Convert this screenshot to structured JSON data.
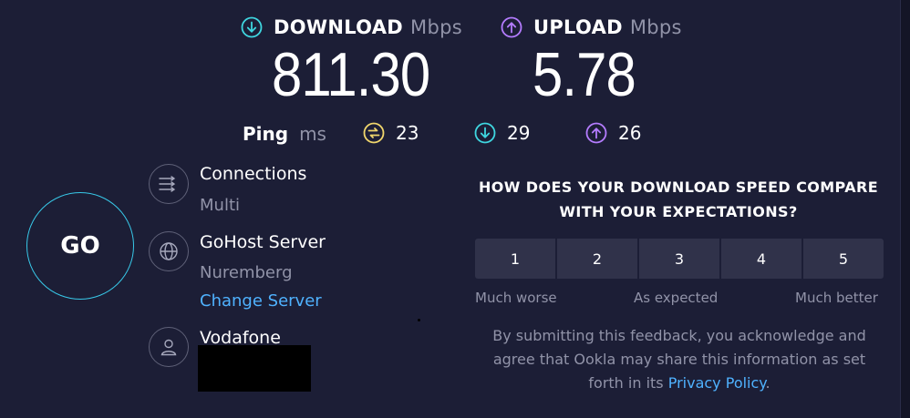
{
  "download": {
    "label": "DOWNLOAD",
    "unit": "Mbps",
    "value": "811.30",
    "icon": "download-arrow-icon",
    "color": "#3fd6e0"
  },
  "upload": {
    "label": "UPLOAD",
    "unit": "Mbps",
    "value": "5.78",
    "icon": "upload-arrow-icon",
    "color": "#b47cff"
  },
  "ping": {
    "label": "Ping",
    "unit": "ms",
    "idle": {
      "value": "23",
      "icon": "ping-idle-icon",
      "color": "#f0d66c"
    },
    "download": {
      "value": "29",
      "icon": "ping-download-icon",
      "color": "#3fd6e0"
    },
    "upload": {
      "value": "26",
      "icon": "ping-upload-icon",
      "color": "#b47cff"
    }
  },
  "go_button": {
    "label": "GO"
  },
  "connections": {
    "title": "Connections",
    "value": "Multi",
    "icon": "connections-icon"
  },
  "server": {
    "title": "GoHost Server",
    "location": "Nuremberg",
    "change_link": "Change Server",
    "icon": "globe-icon"
  },
  "provider": {
    "title": "Vodafone",
    "icon": "user-icon"
  },
  "feedback": {
    "question_line1": "HOW DOES YOUR DOWNLOAD SPEED COMPARE",
    "question_line2": "WITH YOUR EXPECTATIONS?",
    "ratings": [
      "1",
      "2",
      "3",
      "4",
      "5"
    ],
    "scale_low": "Much worse",
    "scale_mid": "As expected",
    "scale_high": "Much better",
    "disclaimer_line1": "By submitting this feedback, you acknowledge and",
    "disclaimer_line2": "agree that Ookla may share this information as set",
    "disclaimer_line3_prefix": "forth in its",
    "privacy_link": "Privacy Policy",
    "disclaimer_suffix": "."
  }
}
